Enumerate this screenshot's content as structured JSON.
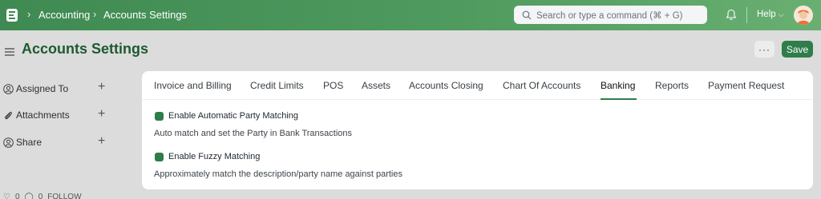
{
  "navbar": {
    "breadcrumbs": [
      "Accounting",
      "Accounts Settings"
    ],
    "search_placeholder": "Search or type a command (⌘ + G)",
    "help_label": "Help"
  },
  "page": {
    "title": "Accounts Settings",
    "more_label": "···",
    "save_label": "Save"
  },
  "sidebar": {
    "items": [
      {
        "label": "Assigned To",
        "icon": "user-assign-icon"
      },
      {
        "label": "Attachments",
        "icon": "paperclip-icon"
      },
      {
        "label": "Share",
        "icon": "share-icon"
      }
    ],
    "footer": {
      "likes": "0",
      "comments": "0",
      "follow": "FOLLOW"
    }
  },
  "tabs": [
    "Invoice and Billing",
    "Credit Limits",
    "POS",
    "Assets",
    "Accounts Closing",
    "Chart Of Accounts",
    "Banking",
    "Reports",
    "Payment Request"
  ],
  "active_tab": "Banking",
  "fields": [
    {
      "label": "Enable Automatic Party Matching",
      "checked": true,
      "description": "Auto match and set the Party in Bank Transactions"
    },
    {
      "label": "Enable Fuzzy Matching",
      "checked": true,
      "description": "Approximately match the description/party name against parties"
    }
  ],
  "colors": {
    "navbar": "#4f9a5e",
    "accent": "#2e7d4a",
    "title": "#1e5a30"
  }
}
